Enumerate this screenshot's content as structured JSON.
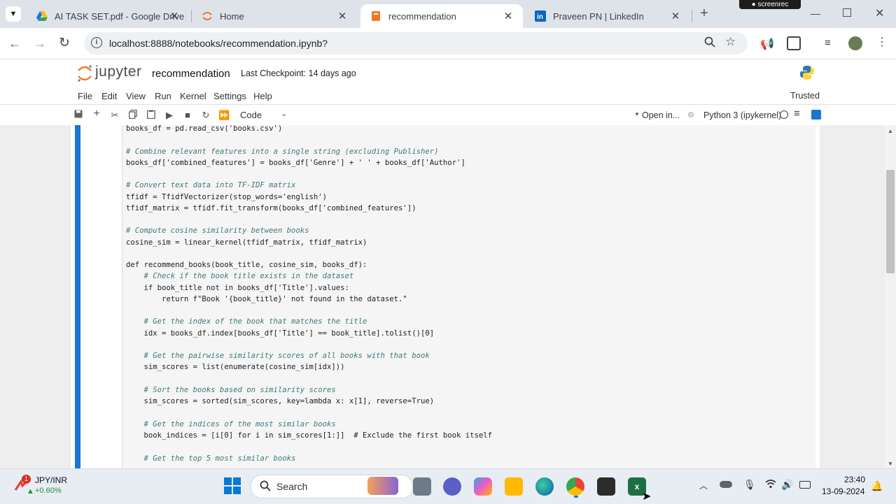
{
  "browser": {
    "tabs": [
      {
        "title": "AI TASK SET.pdf - Google Drive",
        "icon": "google-drive-icon"
      },
      {
        "title": "Home",
        "icon": "jupyter-icon"
      },
      {
        "title": "recommendation",
        "icon": "jupyter-notebook-icon",
        "active": true
      },
      {
        "title": "Praveen PN | LinkedIn",
        "icon": "linkedin-icon"
      }
    ],
    "close_glyph": "✕",
    "new_tab_glyph": "+",
    "url": "localhost:8888/notebooks/recommendation.ipynb?",
    "recorder_label": "screenrec"
  },
  "jupyter": {
    "logo_text": "jupyter",
    "notebook_name": "recommendation",
    "checkpoint": "Last Checkpoint: 14 days ago",
    "menu": [
      "File",
      "Edit",
      "View",
      "Run",
      "Kernel",
      "Settings",
      "Help"
    ],
    "trusted": "Trusted",
    "cell_type": "Code",
    "open_in": "Open in...",
    "kernel": "Python 3 (ipykernel)"
  },
  "code_lines": [
    "books_df = pd.read_csv('books.csv')",
    "",
    "# Combine relevant features into a single string (excluding Publisher)",
    "books_df['combined_features'] = books_df['Genre'] + ' ' + books_df['Author']",
    "",
    "# Convert text data into TF-IDF matrix",
    "tfidf = TfidfVectorizer(stop_words='english')",
    "tfidf_matrix = tfidf.fit_transform(books_df['combined_features'])",
    "",
    "# Compute cosine similarity between books",
    "cosine_sim = linear_kernel(tfidf_matrix, tfidf_matrix)",
    "",
    "def recommend_books(book_title, cosine_sim, books_df):",
    "    # Check if the book title exists in the dataset",
    "    if book_title not in books_df['Title'].values:",
    "        return f\"Book '{book_title}' not found in the dataset.\"",
    "",
    "    # Get the index of the book that matches the title",
    "    idx = books_df.index[books_df['Title'] == book_title].tolist()[0]",
    "",
    "    # Get the pairwise similarity scores of all books with that book",
    "    sim_scores = list(enumerate(cosine_sim[idx]))",
    "",
    "    # Sort the books based on similarity scores",
    "    sim_scores = sorted(sim_scores, key=lambda x: x[1], reverse=True)",
    "",
    "    # Get the indices of the most similar books",
    "    book_indices = [i[0] for i in sim_scores[1:]]  # Exclude the first book itself",
    "",
    "    # Get the top 5 most similar books"
  ],
  "taskbar": {
    "ticker_symbol": "JPY/INR",
    "ticker_change": "+0.60%",
    "ticker_badge": "1",
    "search_label": "Search",
    "time": "23:40",
    "date": "13-09-2024"
  },
  "colors": {
    "accent": "#1976d2",
    "jupyter_orange": "#f37726",
    "comment": "#3d7a7a",
    "string": "#ba2121",
    "keyword": "#008000"
  }
}
